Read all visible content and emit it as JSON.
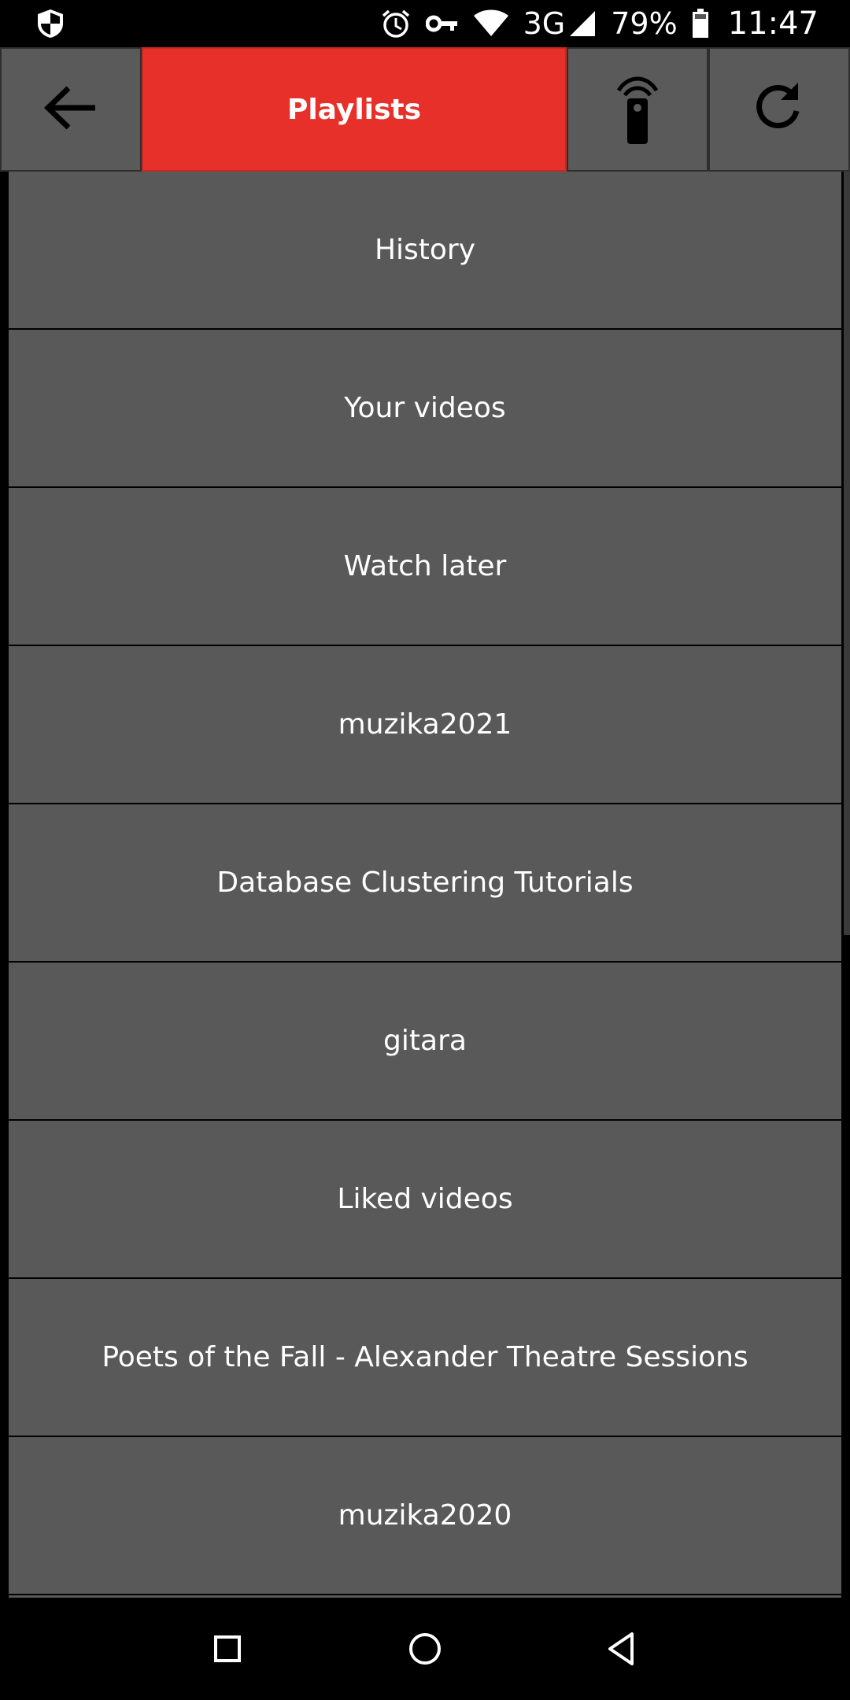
{
  "status_bar": {
    "battery_text": "79%",
    "time": "11:47",
    "network": "3G",
    "icons": [
      "shield-icon",
      "alarm-icon",
      "vpn-key-icon",
      "wifi-icon",
      "signal-icon",
      "battery-icon"
    ]
  },
  "toolbar": {
    "title": "Playlists",
    "accent_color": "#e8302a",
    "icons": [
      "back-arrow-icon",
      "remote-icon",
      "refresh-icon"
    ]
  },
  "playlists": [
    {
      "label": "History"
    },
    {
      "label": "Your videos"
    },
    {
      "label": "Watch later"
    },
    {
      "label": "muzika2021"
    },
    {
      "label": "Database Clustering Tutorials"
    },
    {
      "label": "gitara"
    },
    {
      "label": "Liked videos"
    },
    {
      "label": "Poets of the Fall - Alexander Theatre Sessions"
    },
    {
      "label": "muzika2020"
    }
  ],
  "nav_bar": {
    "icons": [
      "recents-square-icon",
      "home-circle-icon",
      "back-triangle-icon"
    ]
  }
}
